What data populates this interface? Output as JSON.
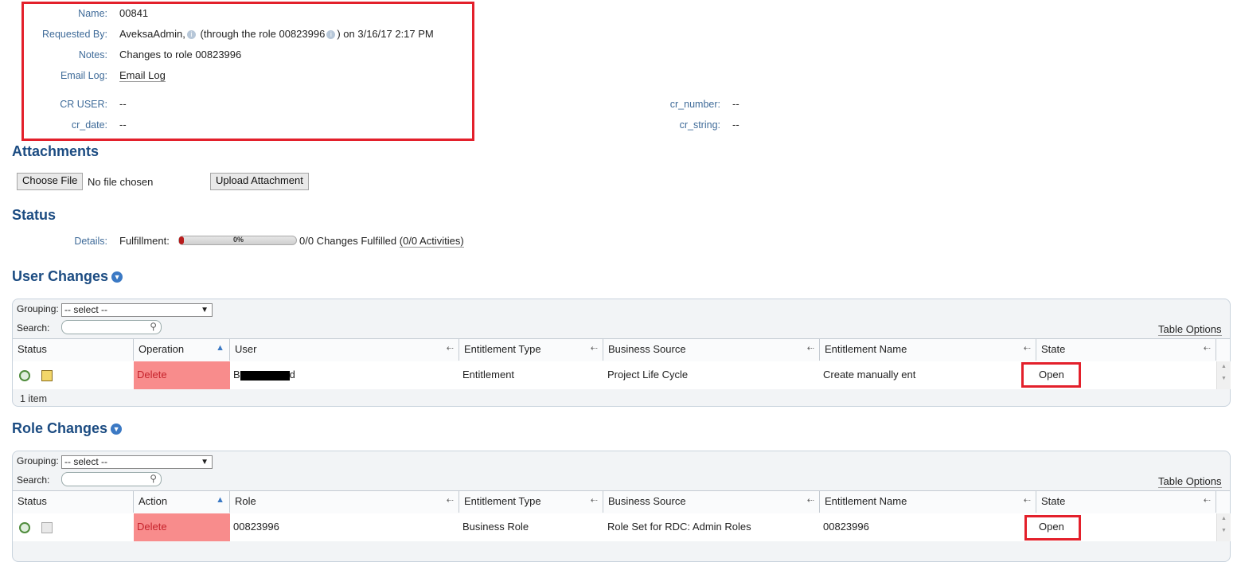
{
  "request": {
    "name_label": "Name:",
    "name_value": "00841",
    "requested_by_label": "Requested By:",
    "requested_by_user": "AveksaAdmin,",
    "requested_by_mid": "(through the role 00823996",
    "requested_by_tail": ") on 3/16/17 2:17 PM",
    "notes_label": "Notes:",
    "notes_value": "Changes to role 00823996",
    "email_log_label": "Email Log:",
    "email_log_link": "Email Log",
    "cr_user_label": "CR USER:",
    "cr_user_value": "--",
    "cr_date_label": "cr_date:",
    "cr_date_value": "--",
    "cr_number_label": "cr_number:",
    "cr_number_value": "--",
    "cr_string_label": "cr_string:",
    "cr_string_value": "--"
  },
  "attachments": {
    "title": "Attachments",
    "choose_file": "Choose File",
    "no_file": "No file chosen",
    "upload": "Upload Attachment"
  },
  "status": {
    "title": "Status",
    "details_label": "Details:",
    "fulfillment_label": "Fulfillment:",
    "progress_text": "0%",
    "progress_value": 0,
    "changes_text": "0/0 Changes Fulfilled",
    "activities_link": "(0/0 Activities)"
  },
  "user_changes": {
    "title": "User Changes",
    "grouping_label": "Grouping:",
    "grouping_value": "-- select --",
    "search_label": "Search:",
    "table_options": "Table Options",
    "columns": [
      "Status",
      "Operation",
      "User",
      "Entitlement Type",
      "Business Source",
      "Entitlement Name",
      "State"
    ],
    "row": {
      "operation": "Delete",
      "user": "B",
      "user_tail": "d",
      "entitlement_type": "Entitlement",
      "business_source": "Project Life Cycle",
      "entitlement_name": "Create manually ent",
      "state": "Open"
    },
    "footer": "1 item"
  },
  "role_changes": {
    "title": "Role Changes",
    "grouping_label": "Grouping:",
    "grouping_value": "-- select --",
    "search_label": "Search:",
    "table_options": "Table Options",
    "columns": [
      "Status",
      "Action",
      "Role",
      "Entitlement Type",
      "Business Source",
      "Entitlement Name",
      "State"
    ],
    "row": {
      "action": "Delete",
      "role": "00823996",
      "entitlement_type": "Business Role",
      "business_source": "Role Set for RDC: Admin Roles",
      "entitlement_name": "00823996",
      "state": "Open"
    }
  },
  "colors": {
    "highlight": "#e3202b",
    "title": "#1c4c82",
    "label": "#3f6b99",
    "delete_bg": "#f88c8c"
  }
}
